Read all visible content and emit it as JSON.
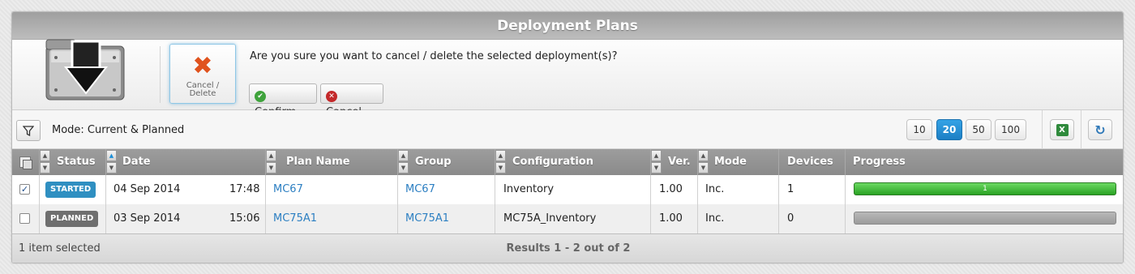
{
  "window": {
    "title": "Deployment Plans"
  },
  "action": {
    "tile_label_line1": "Cancel /",
    "tile_label_line2": "Delete",
    "question": "Are you sure you want to cancel / delete the selected deployment(s)?",
    "confirm_label": "Confirm",
    "cancel_label": "Cancel"
  },
  "toolbar": {
    "mode_text": "Mode: Current & Planned",
    "page_sizes": [
      "10",
      "20",
      "50",
      "100"
    ],
    "active_page_size": "20",
    "excel_label": "X"
  },
  "grid": {
    "columns": {
      "status": "Status",
      "date": "Date",
      "plan_name": "Plan Name",
      "group": "Group",
      "configuration": "Configuration",
      "version": "Ver.",
      "mode": "Mode",
      "devices": "Devices",
      "progress": "Progress"
    },
    "rows": [
      {
        "checked": true,
        "status": "STARTED",
        "date": "04 Sep 2014",
        "time": "17:48",
        "plan_name": "MC67",
        "group": "MC67",
        "configuration": "Inventory",
        "version": "1.00",
        "mode": "Inc.",
        "devices": "1",
        "progress_label": "1",
        "progress_fraction": 1.0
      },
      {
        "checked": false,
        "status": "PLANNED",
        "date": "03 Sep 2014",
        "time": "15:06",
        "plan_name": "MC75A1",
        "group": "MC75A1",
        "configuration": "MC75A_Inventory",
        "version": "1.00",
        "mode": "Inc.",
        "devices": "0",
        "progress_label": "",
        "progress_fraction": 0
      }
    ]
  },
  "footer": {
    "selection_text": "1 item selected",
    "results_text": "Results 1 - 2 out of 2"
  },
  "colors": {
    "accent": "#1c7fc4",
    "started": "#2f8fc1",
    "planned": "#6f6f6f",
    "progress_green": "#2aa224"
  }
}
